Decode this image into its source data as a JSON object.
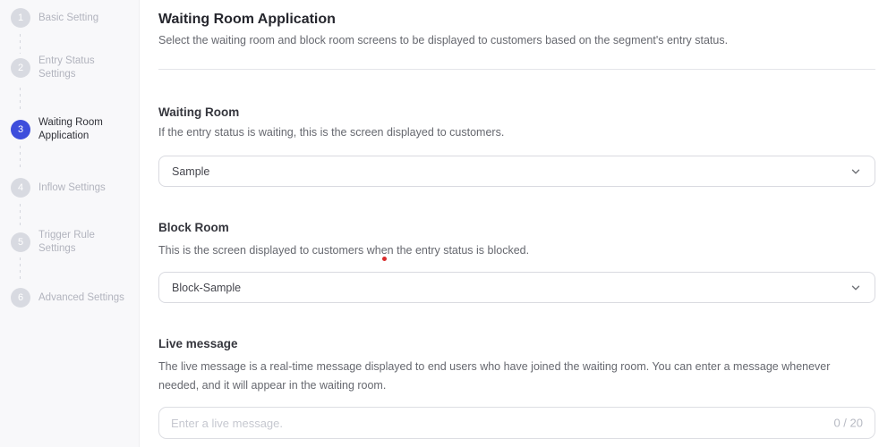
{
  "accent_color": "#3E4EDC",
  "sidebar": {
    "steps": [
      {
        "number": "1",
        "label": "Basic Setting",
        "active": false
      },
      {
        "number": "2",
        "label": "Entry Status Settings",
        "active": false
      },
      {
        "number": "3",
        "label": "Waiting Room Application",
        "active": true
      },
      {
        "number": "4",
        "label": "Inflow Settings",
        "active": false
      },
      {
        "number": "5",
        "label": "Trigger Rule Settings",
        "active": false
      },
      {
        "number": "6",
        "label": "Advanced Settings",
        "active": false
      }
    ]
  },
  "header": {
    "title": "Waiting Room Application",
    "subtitle": "Select the waiting room and block room screens to be displayed to customers based on the segment's entry status."
  },
  "sections": {
    "waiting_room": {
      "heading": "Waiting Room",
      "description": "If the entry status is waiting, this is the screen displayed to customers.",
      "selected_value": "Sample"
    },
    "block_room": {
      "heading": "Block Room",
      "description": "This is the screen displayed to customers when the entry status is blocked.",
      "selected_value": "Block-Sample"
    },
    "live_message": {
      "heading": "Live message",
      "description": "The live message is a real-time message displayed to end users who have joined the waiting room. You can enter a message whenever needed, and it will appear in the waiting room.",
      "input_placeholder": "Enter a live message.",
      "input_value": "",
      "char_counter": "0 / 20"
    }
  },
  "icons": {
    "dropdown_chevron": "chevron-down"
  }
}
